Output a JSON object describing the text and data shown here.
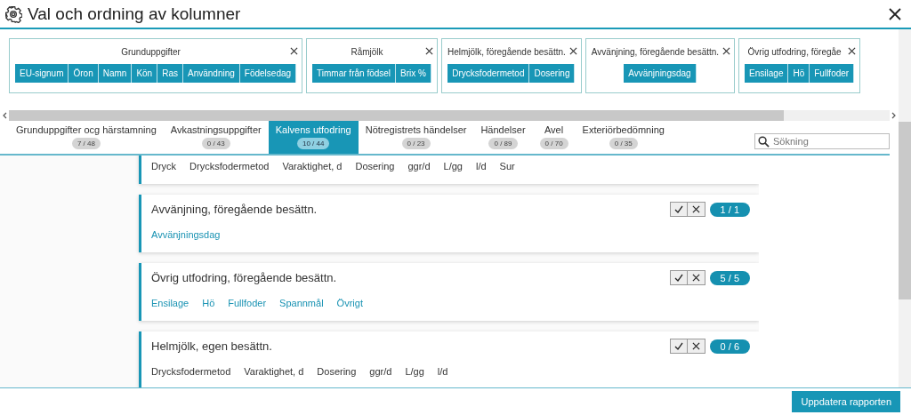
{
  "window": {
    "title": "Val och ordning av kolumner"
  },
  "column_groups": [
    {
      "title": "Grunduppgifter",
      "chips": [
        "EU-signum",
        "Öron",
        "Namn",
        "Kön",
        "Ras",
        "Användning",
        "Födelsedag"
      ]
    },
    {
      "title": "Råmjölk",
      "chips": [
        "Timmar från födsel",
        "Brix %"
      ]
    },
    {
      "title": "Helmjölk, föregående besättn.",
      "chips": [
        "Drycksfodermetod",
        "Dosering"
      ]
    },
    {
      "title": "Avvänjning, föregående besättn.",
      "chips": [
        "Avvänjningsdag"
      ]
    },
    {
      "title": "Övrig utfodring, föregåe",
      "chips": [
        "Ensilage",
        "Hö",
        "Fullfoder"
      ]
    }
  ],
  "tabs": [
    {
      "label": "Grunduppgifter ocg härstamning",
      "count": "7 / 48",
      "selected": false
    },
    {
      "label": "Avkastningsuppgifter",
      "count": "0 / 43",
      "selected": false
    },
    {
      "label": "Kalvens utfodring",
      "count": "10 / 44",
      "selected": true
    },
    {
      "label": "Nötregistrets händelser",
      "count": "0 / 23",
      "selected": false
    },
    {
      "label": "Händelser",
      "count": "0 / 89",
      "selected": false
    },
    {
      "label": "Avel",
      "count": "0 / 70",
      "selected": false
    },
    {
      "label": "Exteriörbedömning",
      "count": "0 / 35",
      "selected": false
    }
  ],
  "search": {
    "placeholder": "Sökning"
  },
  "sections": [
    {
      "items": [
        {
          "label": "Dryck",
          "selected": false
        },
        {
          "label": "Drycksfodermetod",
          "selected": false
        },
        {
          "label": "Varaktighet, d",
          "selected": false
        },
        {
          "label": "Dosering",
          "selected": false
        },
        {
          "label": "ggr/d",
          "selected": false
        },
        {
          "label": "L/gg",
          "selected": false
        },
        {
          "label": "l/d",
          "selected": false
        },
        {
          "label": "Sur",
          "selected": false
        }
      ]
    },
    {
      "title": "Avvänjning, föregående besättn.",
      "count": "1 / 1",
      "items": [
        {
          "label": "Avvänjningsdag",
          "selected": true
        }
      ]
    },
    {
      "title": "Övrig utfodring, föregående besättn.",
      "count": "5 / 5",
      "items": [
        {
          "label": "Ensilage",
          "selected": true
        },
        {
          "label": "Hö",
          "selected": true
        },
        {
          "label": "Fullfoder",
          "selected": true
        },
        {
          "label": "Spannmål",
          "selected": true
        },
        {
          "label": "Övrigt",
          "selected": true
        }
      ]
    },
    {
      "title": "Helmjölk, egen besättn.",
      "count": "0 / 6",
      "items": [
        {
          "label": "Drycksfodermetod",
          "selected": false
        },
        {
          "label": "Varaktighet, d",
          "selected": false
        },
        {
          "label": "Dosering",
          "selected": false
        },
        {
          "label": "ggr/d",
          "selected": false
        },
        {
          "label": "L/gg",
          "selected": false
        },
        {
          "label": "l/d",
          "selected": false
        }
      ]
    }
  ],
  "update_button": "Uppdatera rapporten"
}
